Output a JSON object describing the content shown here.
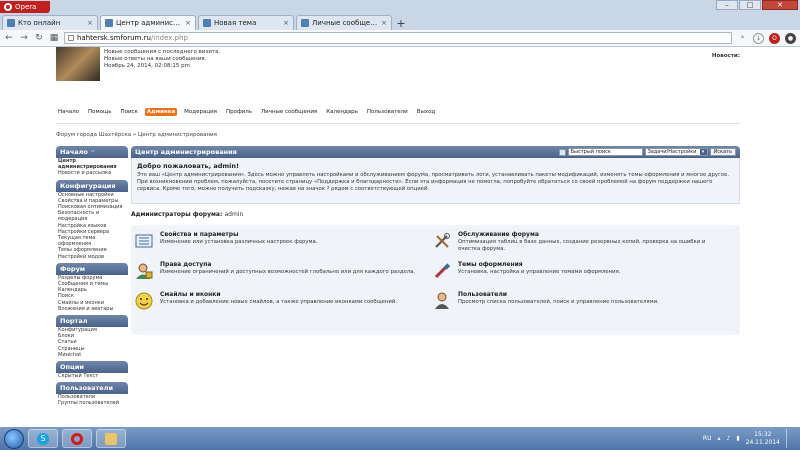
{
  "browser": {
    "menu_label": "Opera",
    "window_buttons": [
      "–",
      "□",
      "✕"
    ],
    "tabs": [
      {
        "label": "Кто онлайн",
        "active": false
      },
      {
        "label": "Центр администрирова",
        "active": true
      },
      {
        "label": "Новая тема",
        "active": false
      },
      {
        "label": "Личные сообщения",
        "active": false
      }
    ],
    "new_tab": "+",
    "url_host": "hahtersk.smforum.ru",
    "url_path": "/index.php"
  },
  "header": {
    "line1": "Новые сообщения с последнего визита.",
    "line2": "Новые ответы на ваши сообщения.",
    "line3": "Ноябрь 24, 2014, 02:08:15 pm",
    "news_label": "Новости:"
  },
  "menu": [
    "Начало",
    "Помощь",
    "Поиск",
    "Админка",
    "Модерация",
    "Профиль",
    "Личные сообщения",
    "Календарь",
    "Пользователи",
    "Выход"
  ],
  "breadcrumb": "Форум города Шахтёрска » Центр администрирования",
  "sidebar": {
    "sections": [
      {
        "title": "Начало",
        "items": [
          "Центр администрирования",
          "Новости и рассылка"
        ]
      },
      {
        "title": "Конфигурация",
        "items": [
          "Основные настройки",
          "Свойства и параметры",
          "Поисковая оптимизация",
          "Безопасность и модерация",
          "Настройка языков",
          "Настройки сервера",
          "Текущая тема оформления",
          "Темы оформления",
          "Настройки модов"
        ]
      },
      {
        "title": "Форум",
        "items": [
          "Разделы форума",
          "Сообщения и темы",
          "Календарь",
          "Поиск",
          "Смайлы и иконки",
          "Вложения и аватары"
        ]
      },
      {
        "title": "Портал",
        "items": [
          "Конфигурация",
          "Блоки",
          "Статьи",
          "Страницы",
          "Минichat"
        ]
      },
      {
        "title": "Опции",
        "items": [
          "Скрытый Текст"
        ]
      },
      {
        "title": "Пользователи",
        "items": [
          "Пользователи",
          "Группы пользователей"
        ]
      }
    ]
  },
  "main": {
    "title": "Центр администрирования",
    "quick_search_value": "Быстрый поиск",
    "quick_search_select": "Задачи/Настройки",
    "quick_search_button": "Искать",
    "welcome_title": "Добро пожаловать, admin!",
    "welcome_text": "Это ваш «Центр администрирования». Здесь можно управлять настройками и обслуживанием форума, просматривать логи, устанавливать пакеты модификаций, изменять темы оформления и многое другое. При возникновении проблем, пожалуйста, посетите страницу «Поддержка и благодарности». Если эта информация не помогла, попробуйте обратиться со своей проблемой на форум поддержки нашего сервиса. Кроме того, можно получить подсказку, нажав на значок ? рядом с соответствующей опцией.",
    "admins_label": "Администраторы форума:",
    "admins_name": "admin",
    "cards": [
      {
        "title": "Свойства и параметры",
        "desc": "Изменение или установка различных настроек форума.",
        "icon": "settings-list-icon"
      },
      {
        "title": "Обслуживание форума",
        "desc": "Оптимизация таблиц в базе данных, создание резервных копий, проверка на ошибки и очистка форума.",
        "icon": "maintenance-tools-icon"
      },
      {
        "title": "Права доступа",
        "desc": "Изменение ограничений и доступных возможностей глобально или для каждого раздела.",
        "icon": "permissions-user-icon"
      },
      {
        "title": "Темы оформления",
        "desc": "Установка, настройка и управление темами оформления.",
        "icon": "themes-brush-icon"
      },
      {
        "title": "Смайлы и иконки",
        "desc": "Установка и добавление новых смайлов, а также управление иконками сообщений.",
        "icon": "smiley-icon"
      },
      {
        "title": "Пользователи",
        "desc": "Просмотр списка пользователей, поиск и управление пользователями.",
        "icon": "members-icon"
      }
    ]
  },
  "taskbar": {
    "lang": "RU",
    "time": "15:32",
    "date": "24.11.2014"
  }
}
